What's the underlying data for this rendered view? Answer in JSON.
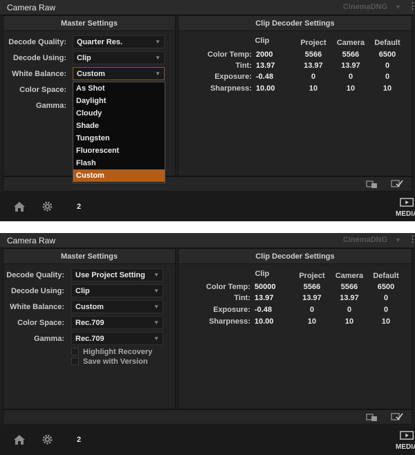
{
  "window": {
    "title": "Camera Raw",
    "raw_format": "CinemaDNG"
  },
  "labels": {
    "decode_quality": "Decode Quality:",
    "decode_using": "Decode Using:",
    "white_balance": "White Balance:",
    "color_space": "Color Space:",
    "gamma": "Gamma:"
  },
  "master_settings": {
    "title": "Master Settings"
  },
  "clip_decoder": {
    "title": "Clip Decoder Settings",
    "columns": [
      "Clip",
      "Project",
      "Camera",
      "Default"
    ],
    "rows": [
      {
        "label": "Color Temp:",
        "values": [
          "2000",
          "5566",
          "5566",
          "6500"
        ]
      },
      {
        "label": "Tint:",
        "values": [
          "13.97",
          "13.97",
          "13.97",
          "0"
        ]
      },
      {
        "label": "Exposure:",
        "values": [
          "-0.48",
          "0",
          "0",
          "0"
        ]
      },
      {
        "label": "Sharpness:",
        "values": [
          "10.00",
          "10",
          "10",
          "10"
        ]
      }
    ]
  },
  "screenshot1": {
    "decode_quality": "Quarter Res.",
    "decode_using": "Clip",
    "white_balance": "Custom",
    "white_balance_options": [
      "As Shot",
      "Daylight",
      "Cloudy",
      "Shade",
      "Tungsten",
      "Fluorescent",
      "Flash",
      "Custom"
    ],
    "selected_option": "Custom",
    "color_temp_clip": "2000"
  },
  "screenshot2": {
    "decode_quality": "Use Project Setting",
    "decode_using": "Clip",
    "white_balance": "Custom",
    "color_space": "Rec.709",
    "gamma": "Rec.709",
    "color_temp_clip": "50000",
    "checkboxes": [
      {
        "label": "Highlight Recovery",
        "checked": false
      },
      {
        "label": "Save with Version",
        "checked": false
      }
    ]
  },
  "footer": {
    "page_number": "2",
    "media_label": "MEDIA"
  },
  "icons": {
    "home": "home-icon",
    "settings": "gear-icon",
    "media": "media-icon",
    "status_left": "clip-info-icon",
    "status_right": "checklist-icon"
  }
}
